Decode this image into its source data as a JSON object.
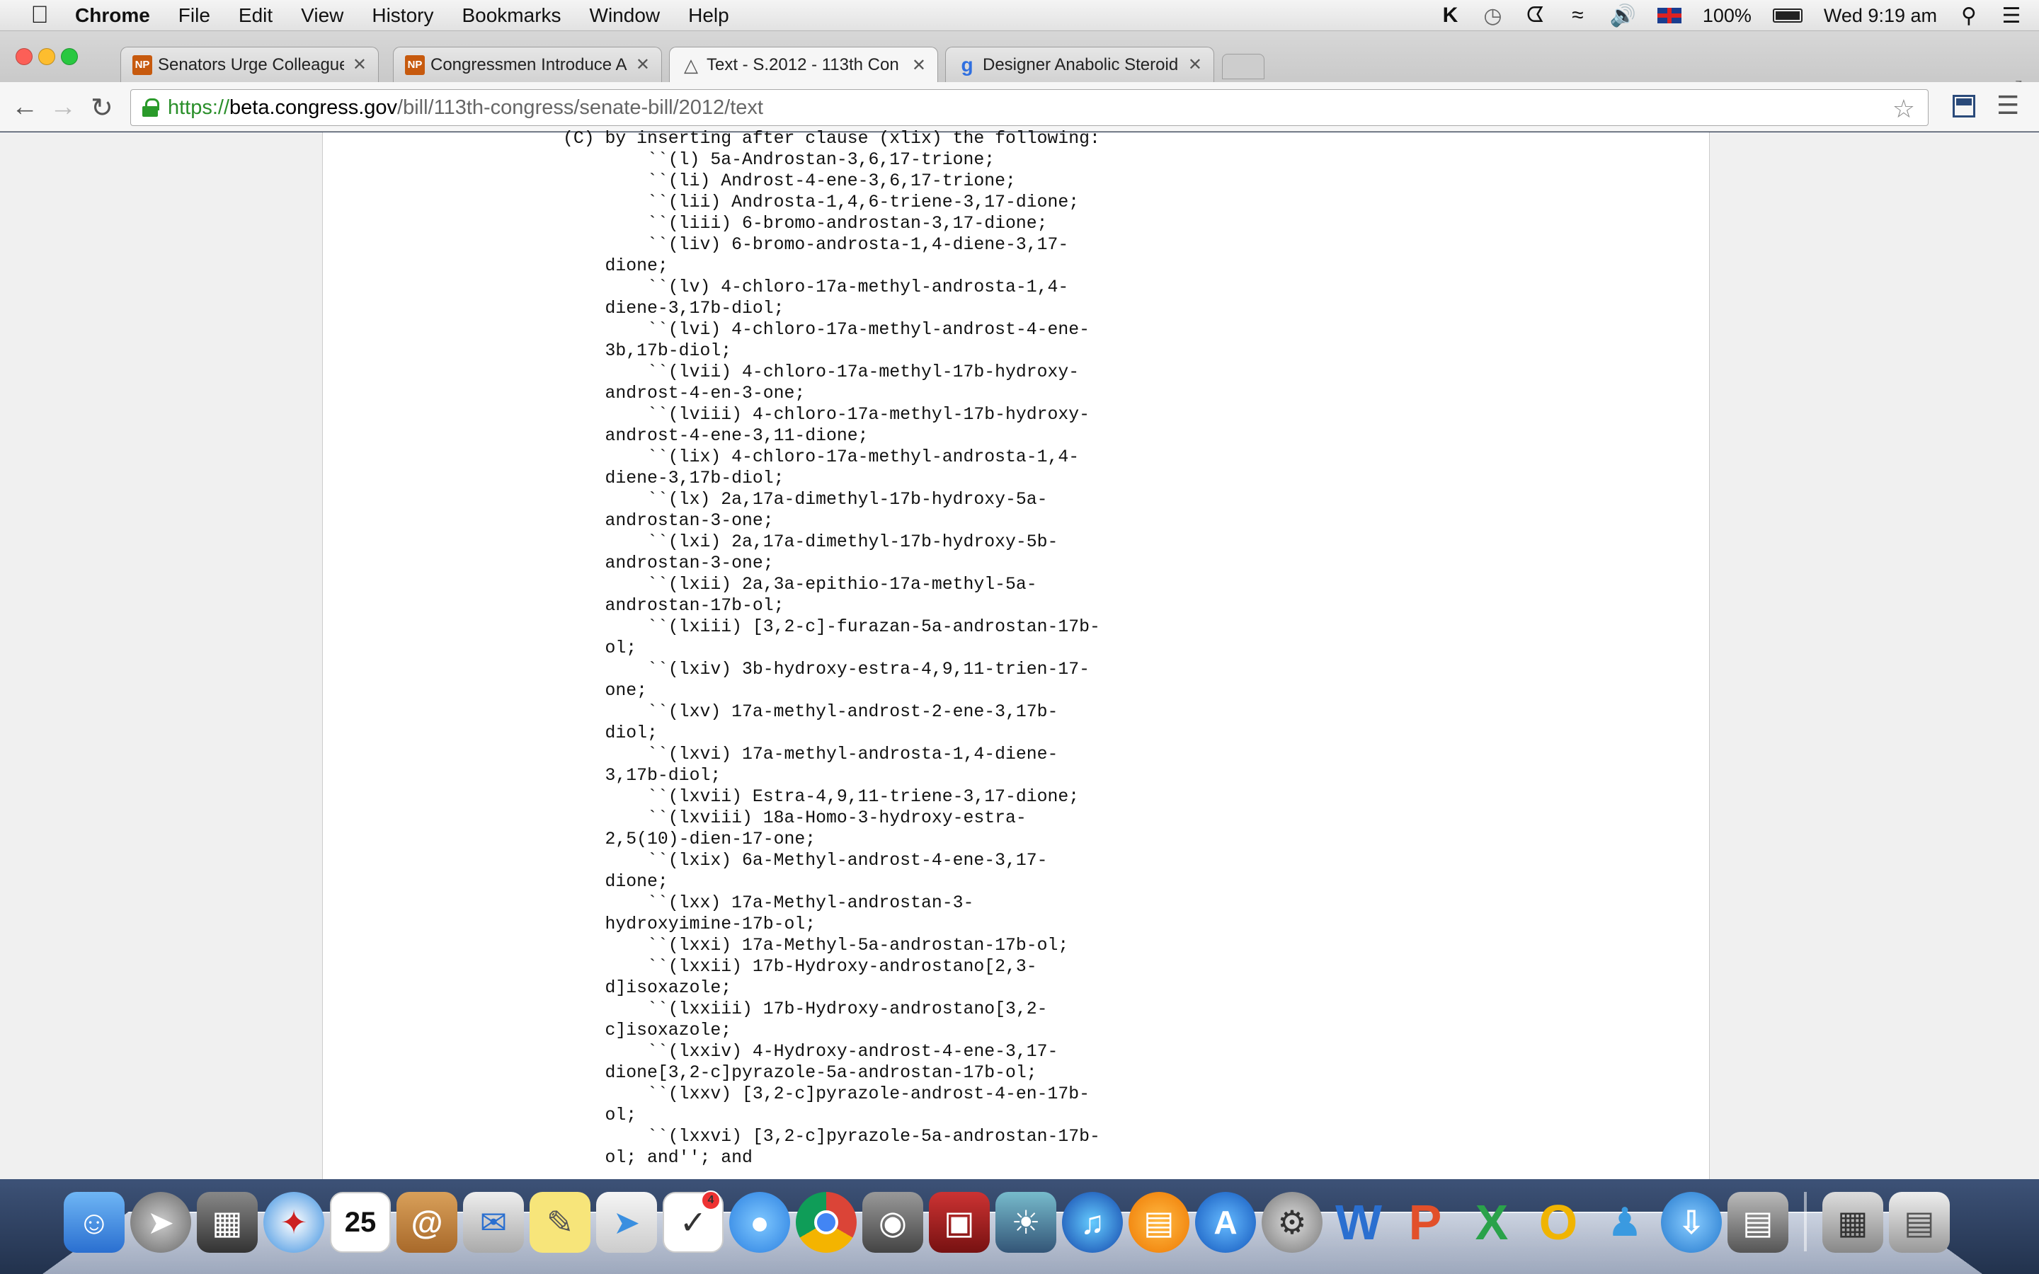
{
  "menubar": {
    "app_name": "Chrome",
    "items": [
      "File",
      "Edit",
      "View",
      "History",
      "Bookmarks",
      "Window",
      "Help"
    ],
    "status": {
      "battery": "100%",
      "clock": "Wed 9:19 am"
    }
  },
  "tabs": [
    {
      "favicon": "NP",
      "title": "Senators Urge Colleagues t",
      "active": false
    },
    {
      "favicon": "NP",
      "title": "Congressmen Introduce Ar",
      "active": false
    },
    {
      "favicon": "gov-icon",
      "title": "Text - S.2012 - 113th Con",
      "active": true
    },
    {
      "favicon": "g",
      "title": "Designer Anabolic Steroid",
      "active": false
    }
  ],
  "omnibox": {
    "scheme": "https://",
    "host": "beta.congress.gov",
    "path": "/bill/113th-congress/senate-bill/2012/text"
  },
  "bill_text": "(C) by inserting after clause (xlix) the following:\n        ``(l) 5a-Androstan-3,6,17-trione;\n        ``(li) Androst-4-ene-3,6,17-trione;\n        ``(lii) Androsta-1,4,6-triene-3,17-dione;\n        ``(liii) 6-bromo-androstan-3,17-dione;\n        ``(liv) 6-bromo-androsta-1,4-diene-3,17-\n    dione;\n        ``(lv) 4-chloro-17a-methyl-androsta-1,4-\n    diene-3,17b-diol;\n        ``(lvi) 4-chloro-17a-methyl-androst-4-ene-\n    3b,17b-diol;\n        ``(lvii) 4-chloro-17a-methyl-17b-hydroxy-\n    androst-4-en-3-one;\n        ``(lviii) 4-chloro-17a-methyl-17b-hydroxy-\n    androst-4-ene-3,11-dione;\n        ``(lix) 4-chloro-17a-methyl-androsta-1,4-\n    diene-3,17b-diol;\n        ``(lx) 2a,17a-dimethyl-17b-hydroxy-5a-\n    androstan-3-one;\n        ``(lxi) 2a,17a-dimethyl-17b-hydroxy-5b-\n    androstan-3-one;\n        ``(lxii) 2a,3a-epithio-17a-methyl-5a-\n    androstan-17b-ol;\n        ``(lxiii) [3,2-c]-furazan-5a-androstan-17b-\n    ol;\n        ``(lxiv) 3b-hydroxy-estra-4,9,11-trien-17-\n    one;\n        ``(lxv) 17a-methyl-androst-2-ene-3,17b-\n    diol;\n        ``(lxvi) 17a-methyl-androsta-1,4-diene-\n    3,17b-diol;\n        ``(lxvii) Estra-4,9,11-triene-3,17-dione;\n        ``(lxviii) 18a-Homo-3-hydroxy-estra-\n    2,5(10)-dien-17-one;\n        ``(lxix) 6a-Methyl-androst-4-ene-3,17-\n    dione;\n        ``(lxx) 17a-Methyl-androstan-3-\n    hydroxyimine-17b-ol;\n        ``(lxxi) 17a-Methyl-5a-androstan-17b-ol;\n        ``(lxxii) 17b-Hydroxy-androstano[2,3-\n    d]isoxazole;\n        ``(lxxiii) 17b-Hydroxy-androstano[3,2-\n    c]isoxazole;\n        ``(lxxiv) 4-Hydroxy-androst-4-ene-3,17-\n    dione[3,2-c]pyrazole-5a-androstan-17b-ol;\n        ``(lxxv) [3,2-c]pyrazole-androst-4-en-17b-\n    ol;\n        ``(lxxvi) [3,2-c]pyrazole-5a-androstan-17b-\n    ol; and''; and",
  "dock": {
    "calendar_day": "25",
    "reminders_badge": "4"
  }
}
